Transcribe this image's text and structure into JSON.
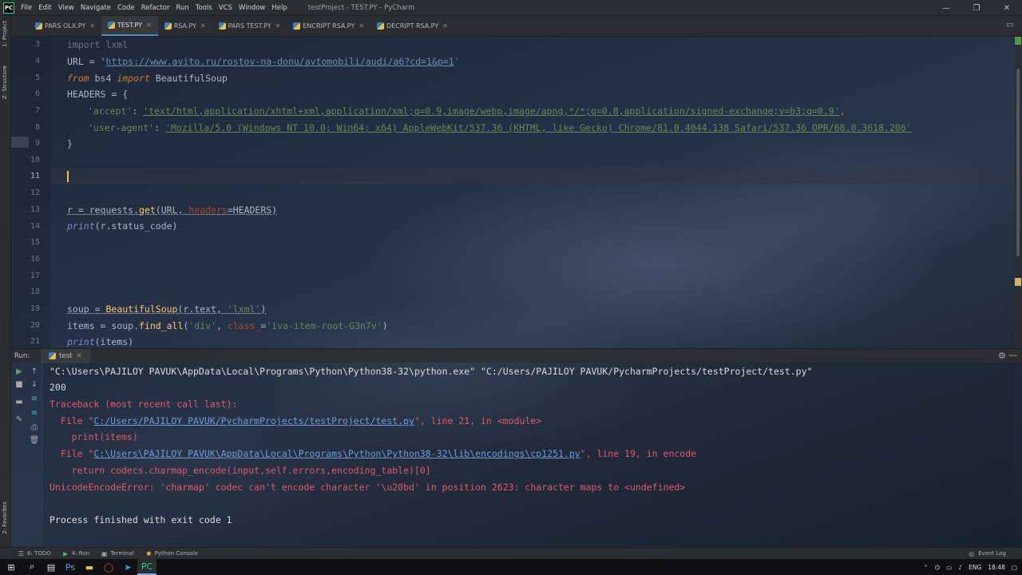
{
  "window": {
    "title": "testProject - TEST.PY - PyCharm",
    "menu": [
      "File",
      "Edit",
      "View",
      "Navigate",
      "Code",
      "Refactor",
      "Run",
      "Tools",
      "VCS",
      "Window",
      "Help"
    ],
    "controls": {
      "minimize": "—",
      "restore": "❐",
      "close": "✕"
    }
  },
  "left_strip": {
    "project_tab": "1: Project",
    "structure_tab": "Z: Structure",
    "favorites_tab": "2: Favorites"
  },
  "tabs": [
    {
      "label": "PARS OLX.PY",
      "active": false
    },
    {
      "label": "TEST.PY",
      "active": true
    },
    {
      "label": "RSA.PY",
      "active": false
    },
    {
      "label": "PARS TEST.PY",
      "active": false
    },
    {
      "label": "ENCRIPT RSA.PY",
      "active": false
    },
    {
      "label": "DECRIPT RSA.PY",
      "active": false
    }
  ],
  "editor": {
    "line_numbers": [
      "3",
      "4",
      "5",
      "6",
      "7",
      "8",
      "9",
      "10",
      "11",
      "12",
      "13",
      "14",
      "15",
      "16",
      "17",
      "18",
      "19",
      "20",
      "21"
    ],
    "current_line": "11",
    "code": {
      "l3": "import lxml",
      "l4_a": "URL = '",
      "l4_url": "https://www.avito.ru/rostov-na-donu/avtomobili/audi/a6?cd=1&p=1",
      "l4_b": "'",
      "l5_from": "from",
      "l5_mid": " bs4 ",
      "l5_import": "import",
      "l5_end": " BeautifulSoup",
      "l6": "HEADERS = {",
      "l7_key": "'accept'",
      "l7_colon": ": ",
      "l7_val": "'text/html,application/xhtml+xml,application/xml;q=0.9,image/webp,image/apng,*/*;q=0.8,application/signed-exchange;v=b3;q=0.9'",
      "l7_end": ",",
      "l8_key": "'user-agent'",
      "l8_colon": ": ",
      "l8_val": "'Mozilla/5.0 (Windows NT 10.0; Win64; x64) AppleWebKit/537.36 (KHTML, like Gecko) Chrome/81.0.4044.138 Safari/537.36 OPR/68.0.3618.206'",
      "l9": "}",
      "l13_a": "r = requests.",
      "l13_get": "get",
      "l13_b": "(URL, ",
      "l13_param": "headers",
      "l13_c": "=HEADERS)",
      "l14_print": "print",
      "l14_b": "(r.status_code)",
      "l19_a": "soup = ",
      "l19_bs": "BeautifulSoup",
      "l19_b": "(r.text, ",
      "l19_str": "'lxml'",
      "l19_c": ")",
      "l20_a": "items = soup.",
      "l20_fn": "find_all",
      "l20_b": "(",
      "l20_s1": "'div'",
      "l20_c": ", ",
      "l20_param": "class_",
      "l20_d": "=",
      "l20_s2": "'iva-item-root-G3n7v'",
      "l20_e": ")",
      "l21_print": "print",
      "l21_b": "(items)"
    }
  },
  "run_panel": {
    "label": "Run:",
    "tab": "test",
    "console": {
      "cmd": "\"C:\\Users\\PAJILOY PAVUK\\AppData\\Local\\Programs\\Python\\Python38-32\\python.exe\" \"C:/Users/PAJILOY PAVUK/PycharmProjects/testProject/test.py\"",
      "status": "200",
      "traceback": "Traceback (most recent call last):",
      "file1_a": "  File \"",
      "file1_link": "C:/Users/PAJILOY PAVUK/PycharmProjects/testProject/test.py",
      "file1_b": "\", line 21, in <module>",
      "code1": "    print(items)",
      "file2_a": "  File \"",
      "file2_link": "C:\\Users\\PAJILOY PAVUK\\AppData\\Local\\Programs\\Python\\Python38-32\\lib\\encodings\\cp1251.py",
      "file2_b": "\", line 19, in encode",
      "code2": "    return codecs.charmap_encode(input,self.errors,encoding_table)[0]",
      "error": "UnicodeEncodeError: 'charmap' codec can't encode character '\\u20bd' in position 2623: character maps to <undefined>",
      "finish": "Process finished with exit code 1"
    }
  },
  "bottom_tools": [
    {
      "label": "6: TODO",
      "icon": "todo-icon"
    },
    {
      "label": "4: Run",
      "icon": "run-icon"
    },
    {
      "label": "Terminal",
      "icon": "terminal-icon"
    },
    {
      "label": "Python Console",
      "icon": "python-console-icon"
    }
  ],
  "event_log": "Event Log",
  "taskbar": {
    "lang": "ENG",
    "time": "18:48"
  },
  "colors": {
    "keyword": "#cc7832",
    "string": "#6a8759",
    "error": "#e05a6a",
    "link": "#6e9cdc",
    "caret": "#e8c340"
  }
}
